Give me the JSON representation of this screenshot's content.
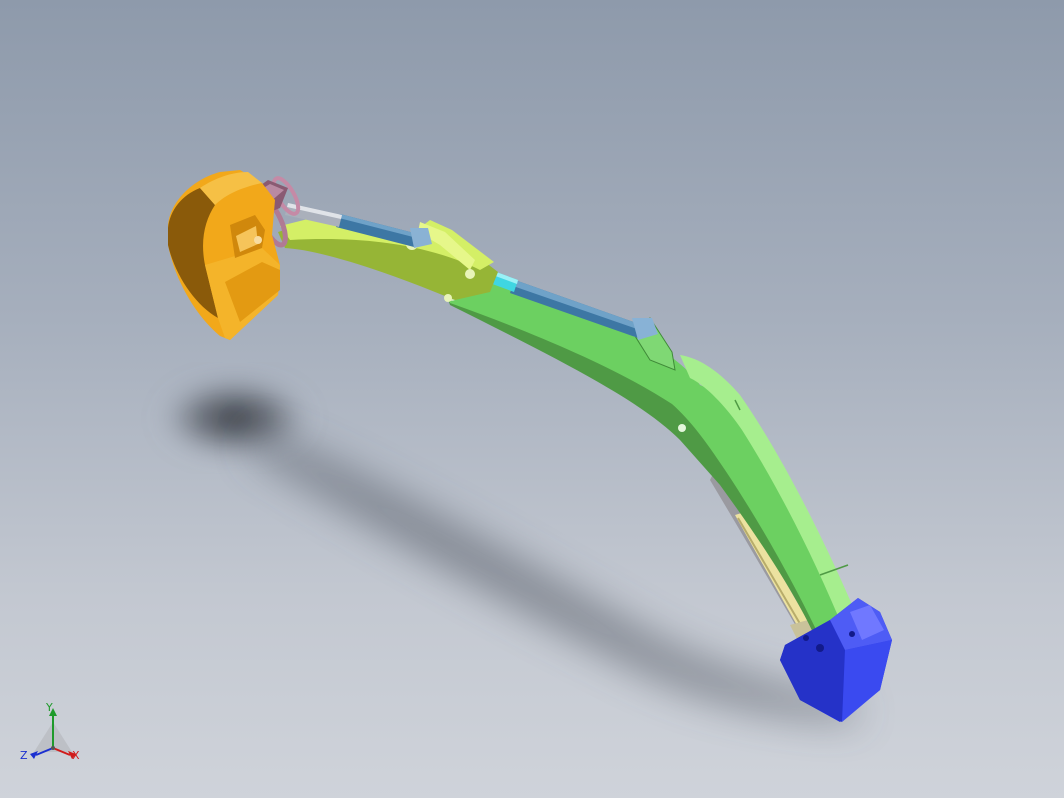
{
  "viewport": {
    "background_top": "#8e9aab",
    "background_bottom": "#cfd3da"
  },
  "model": {
    "parts": [
      {
        "name": "bucket",
        "color": "#f2a515"
      },
      {
        "name": "bucket-link",
        "color": "#a07088"
      },
      {
        "name": "bucket-cylinder",
        "color": "#3f7aa5"
      },
      {
        "name": "arm",
        "color": "#a8c43a"
      },
      {
        "name": "arm-cylinder",
        "color": "#3f7aa5"
      },
      {
        "name": "boom",
        "color": "#6fd46a"
      },
      {
        "name": "boom-cylinder",
        "color": "#e4d88f"
      },
      {
        "name": "base-mount",
        "color": "#1f2fd6"
      }
    ]
  },
  "triad": {
    "y_label": "Y",
    "x_label": "X",
    "z_label": "Z",
    "y_color": "#1f9a2b",
    "x_color": "#d01b1b",
    "z_color": "#1a2fd0",
    "icon": "coordinate-triad-icon"
  }
}
